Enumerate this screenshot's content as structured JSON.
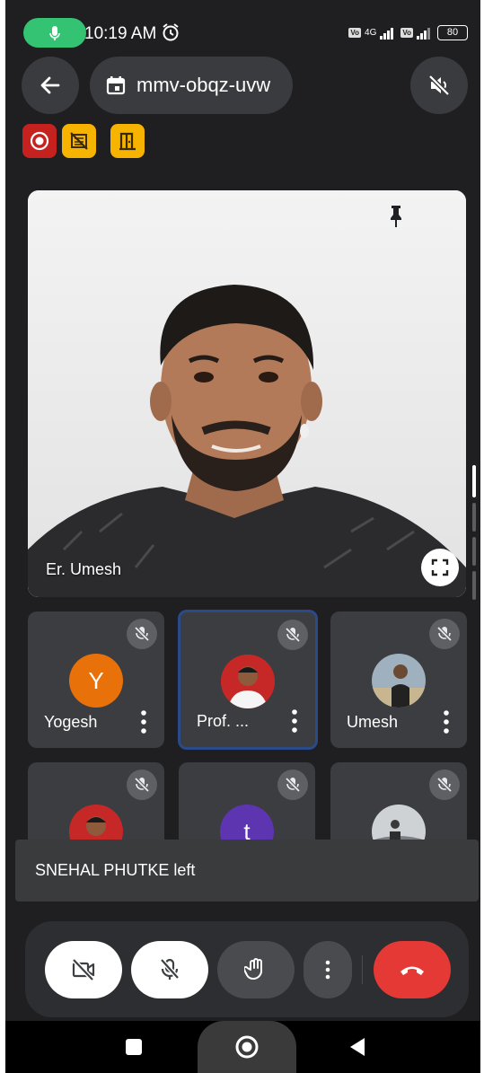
{
  "status_bar": {
    "time": "10:19 AM",
    "network": "4G",
    "battery": "80"
  },
  "top_bar": {
    "meeting_code": "mmv-obqz-uvw"
  },
  "main_tile": {
    "participant_name": "Er. Umesh"
  },
  "participants": [
    {
      "name": "Yogesh",
      "initial": "Y",
      "avatar_color": "#e8710a"
    },
    {
      "name": "Prof. ...",
      "initial": "",
      "avatar_color": "#c62828"
    },
    {
      "name": "Umesh",
      "initial": "",
      "avatar_color": "#6d7b8a"
    },
    {
      "name": "",
      "initial": "",
      "avatar_color": "#c62828"
    },
    {
      "name": "",
      "initial": "t",
      "avatar_color": "#5e35b1"
    },
    {
      "name": "",
      "initial": "",
      "avatar_color": "#8a8f94"
    }
  ],
  "toast": {
    "message": "SNEHAL PHUTKE left"
  },
  "colors": {
    "background": "#1f1f21",
    "end_call": "#e53935",
    "recording": "#c5221f",
    "warning_badge": "#f6b300",
    "mic_active": "#33c372"
  }
}
